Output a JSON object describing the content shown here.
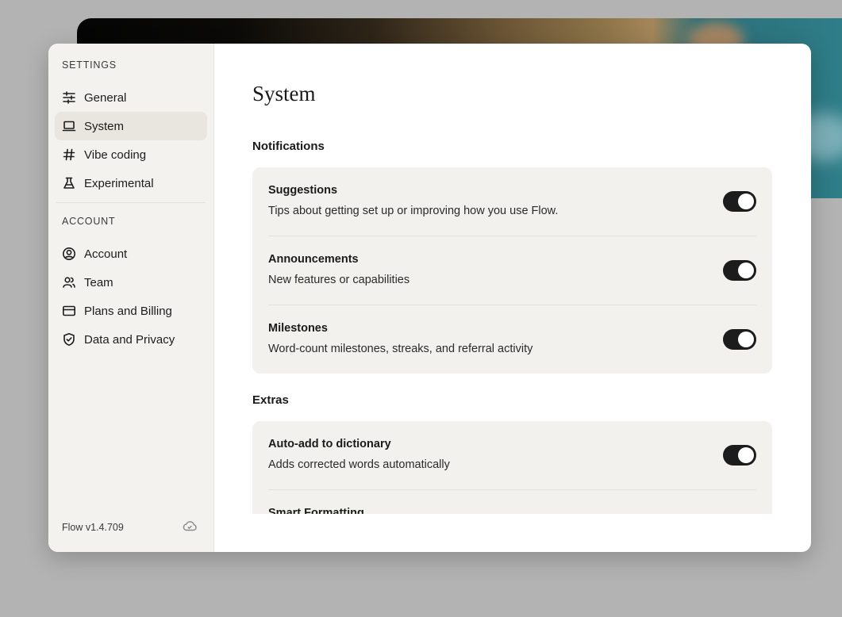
{
  "sidebar": {
    "settings_label": "SETTINGS",
    "settings_items": [
      {
        "label": "General",
        "icon": "sliders-icon"
      },
      {
        "label": "System",
        "icon": "laptop-icon",
        "active": true
      },
      {
        "label": "Vibe coding",
        "icon": "hash-icon"
      },
      {
        "label": "Experimental",
        "icon": "flask-icon"
      }
    ],
    "account_label": "ACCOUNT",
    "account_items": [
      {
        "label": "Account",
        "icon": "user-circle-icon"
      },
      {
        "label": "Team",
        "icon": "team-icon"
      },
      {
        "label": "Plans and Billing",
        "icon": "credit-card-icon"
      },
      {
        "label": "Data and Privacy",
        "icon": "shield-check-icon"
      }
    ],
    "version": "Flow v1.4.709"
  },
  "main": {
    "title": "System",
    "notifications": {
      "heading": "Notifications",
      "rows": [
        {
          "title": "Suggestions",
          "desc": "Tips about getting set up or improving how you use Flow.",
          "enabled": true
        },
        {
          "title": "Announcements",
          "desc": "New features or capabilities",
          "enabled": true
        },
        {
          "title": "Milestones",
          "desc": "Word-count milestones, streaks, and referral activity",
          "enabled": true
        }
      ]
    },
    "extras": {
      "heading": "Extras",
      "rows": [
        {
          "title": "Auto-add to dictionary",
          "desc": "Adds corrected words automatically",
          "enabled": true
        },
        {
          "title": "Smart Formatting",
          "desc": "",
          "enabled": true
        }
      ]
    }
  }
}
